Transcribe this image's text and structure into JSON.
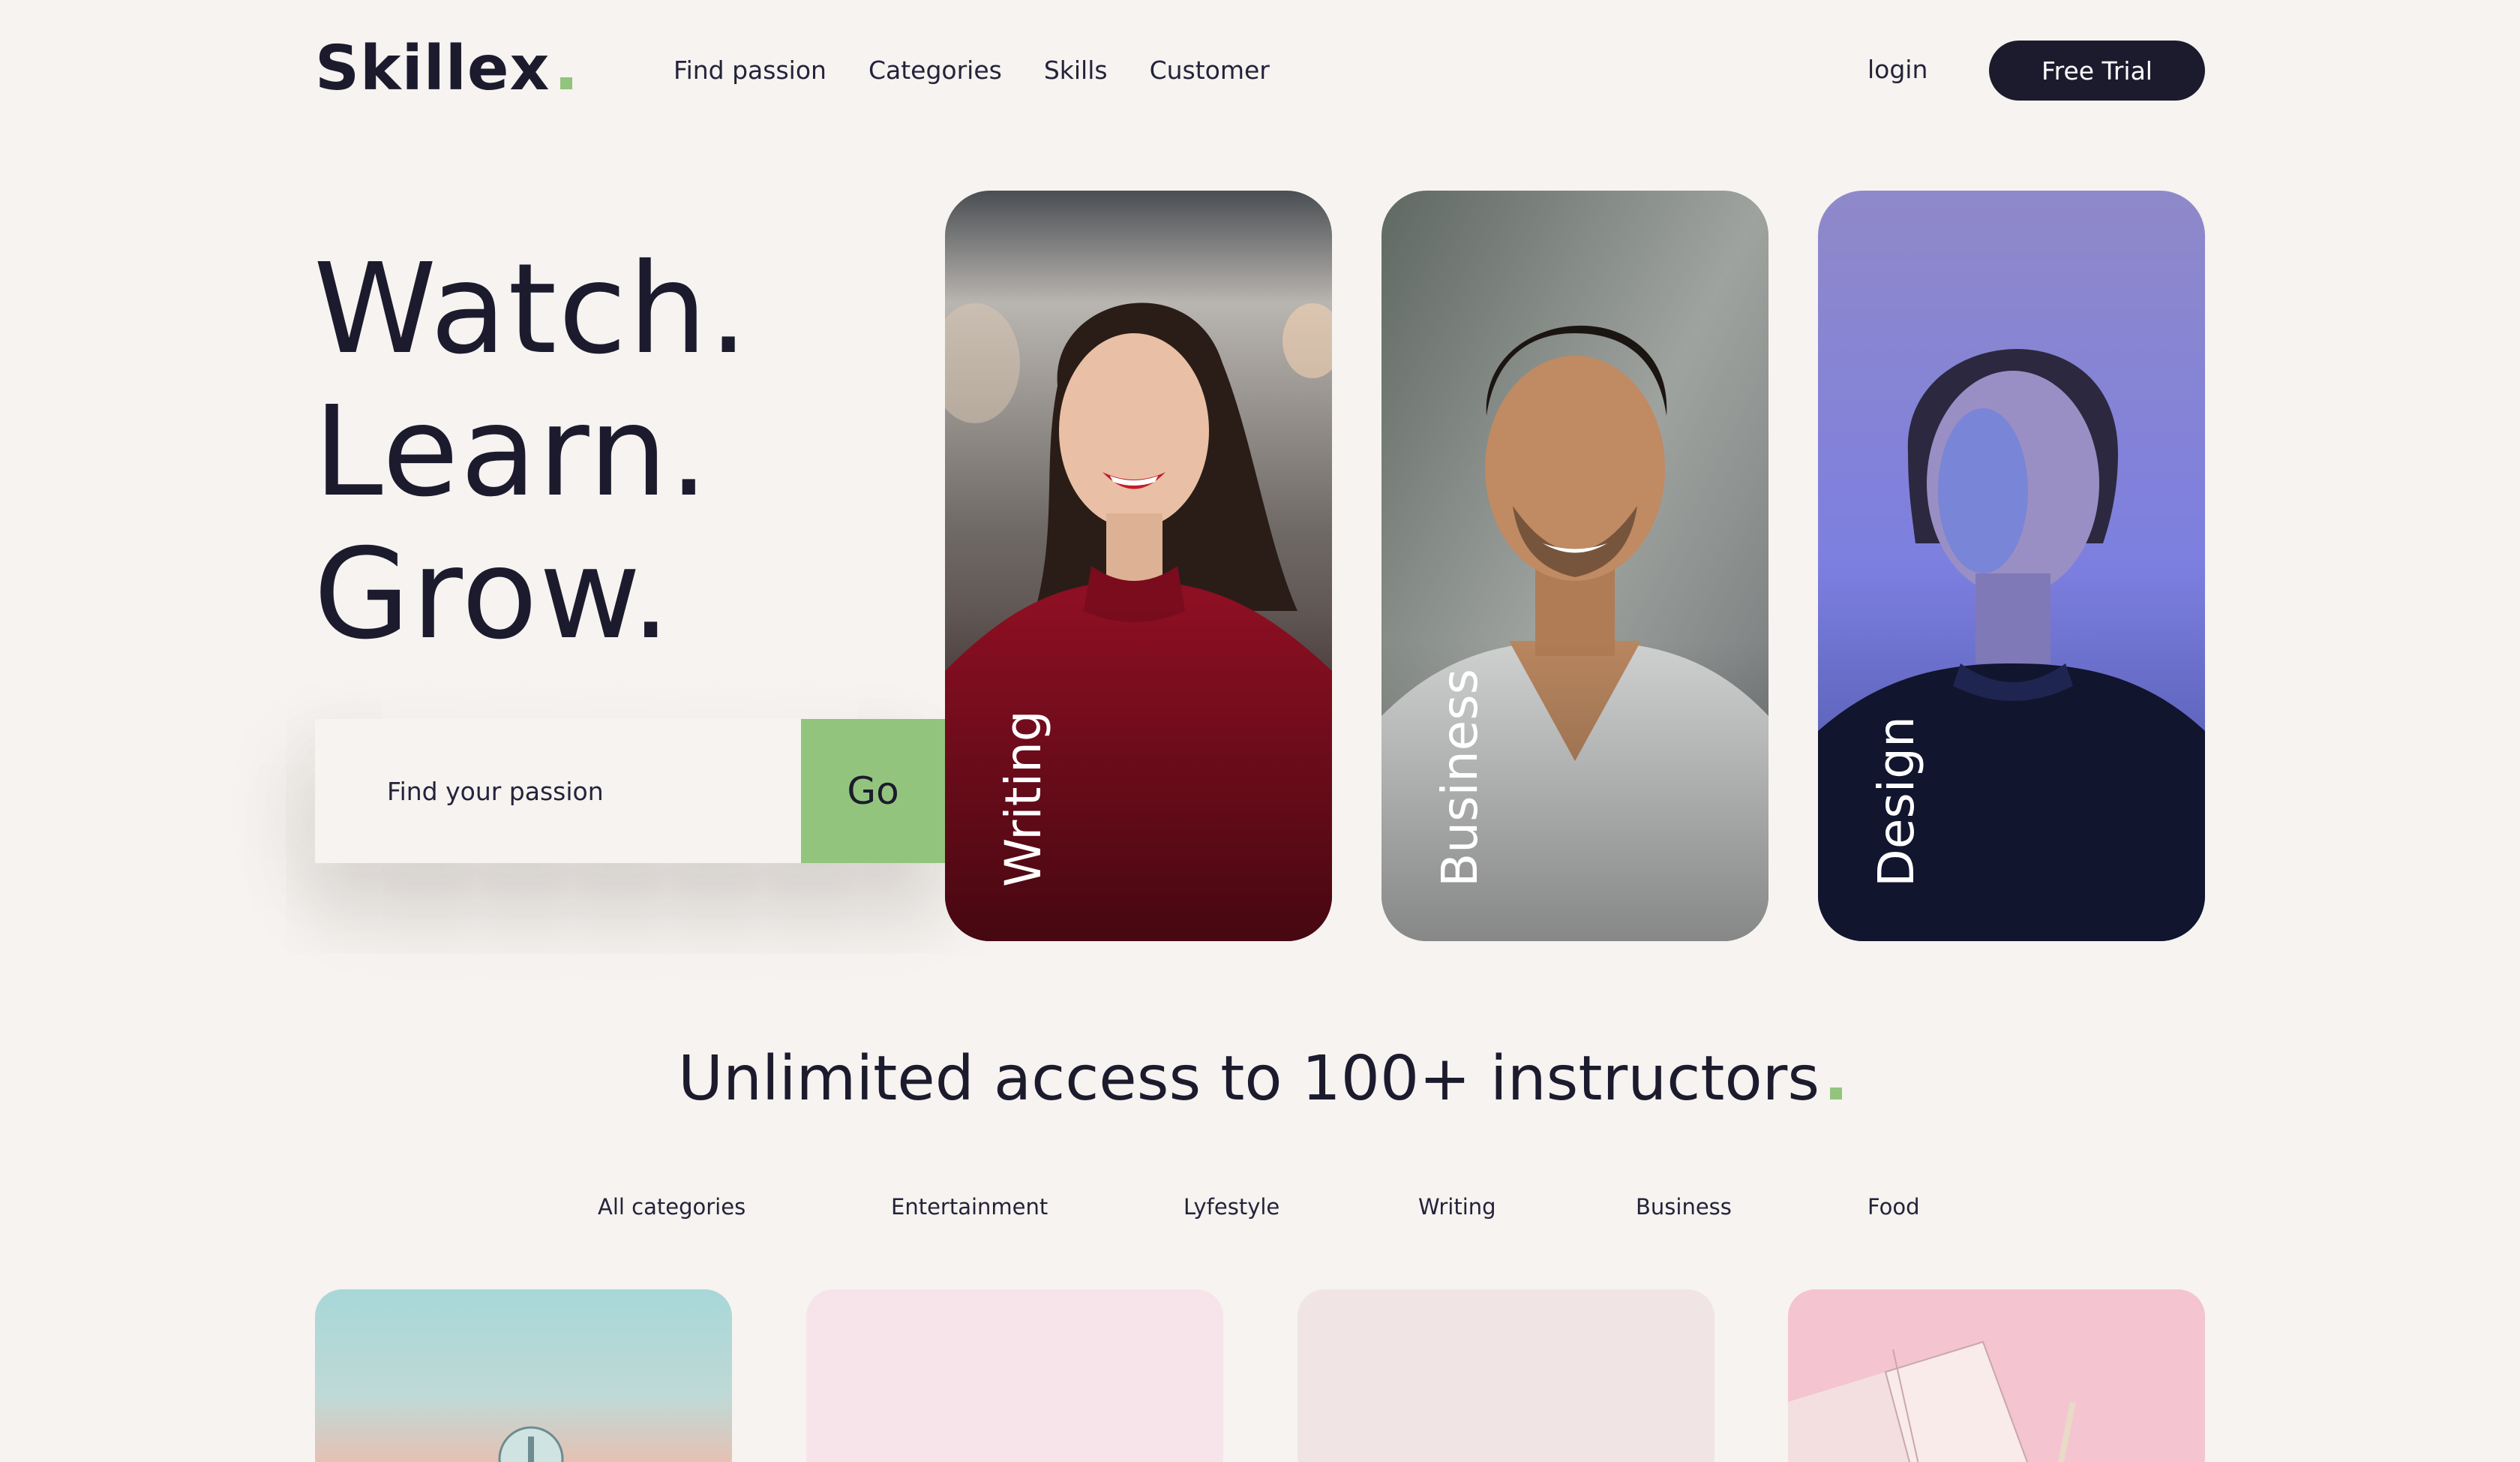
{
  "header": {
    "logo": "Skillex",
    "nav": [
      "Find passion",
      "Categories",
      "Skills",
      "Customer"
    ],
    "login": "login",
    "trial_button": "Free Trial"
  },
  "hero": {
    "lines": [
      "Watch.",
      "Learn.",
      "Grow."
    ],
    "search_placeholder": "Find your passion",
    "go_button": "Go"
  },
  "cards": [
    {
      "label": "Writing"
    },
    {
      "label": "Business"
    },
    {
      "label": "Design"
    }
  ],
  "section": {
    "title": "Unlimited access to 100+ instructors"
  },
  "categories": [
    "All categories",
    "Entertainment",
    "Lyfestyle",
    "Writing",
    "Business",
    "Food"
  ],
  "colors": {
    "background": "#f6f3f0",
    "primary": "#1c1b2e",
    "accent": "#93c47d"
  }
}
